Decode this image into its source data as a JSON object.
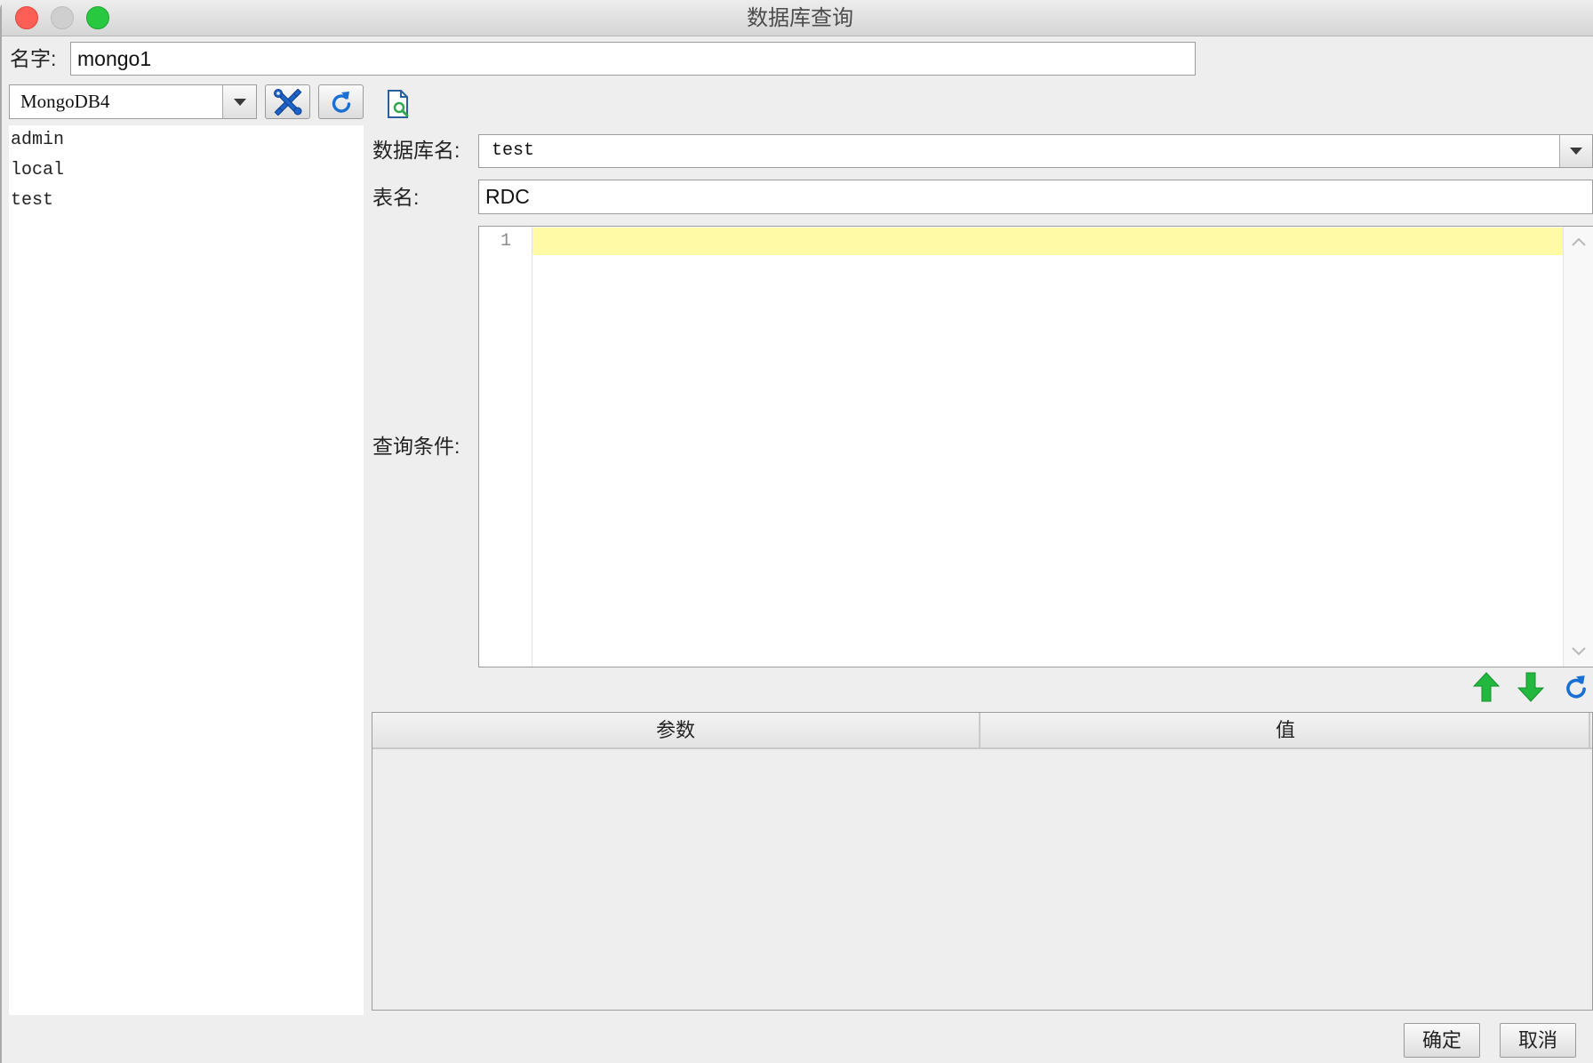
{
  "window": {
    "title": "数据库查询"
  },
  "name_row": {
    "label": "名字:",
    "value": "mongo1"
  },
  "datasource": {
    "selected": "MongoDB4"
  },
  "toolbar": {
    "icons": {
      "config": "tools-icon",
      "refresh": "refresh-icon",
      "preview": "document-search-icon"
    }
  },
  "db_list": {
    "items": [
      "admin",
      "local",
      "test"
    ]
  },
  "form": {
    "db_label": "数据库名:",
    "db_value": "test",
    "table_label": "表名:",
    "table_value": "RDC",
    "query_label": "查询条件:"
  },
  "editor": {
    "line_numbers": [
      "1"
    ],
    "lines": [
      ""
    ]
  },
  "params_toolbar": {
    "icons": {
      "move_up": "arrow-up-icon",
      "move_down": "arrow-down-icon",
      "refresh": "refresh-icon"
    }
  },
  "params_table": {
    "columns": [
      "参数",
      "值"
    ],
    "rows": []
  },
  "footer": {
    "ok_label": "确定",
    "cancel_label": "取消"
  },
  "colors": {
    "window_bg": "#eeeeee",
    "current_line_highlight": "#fffaa6",
    "icon_blue": "#1a6fd4",
    "arrow_green": "#22b83f",
    "close_light": "#fd5e56",
    "zoom_light": "#28c840"
  }
}
